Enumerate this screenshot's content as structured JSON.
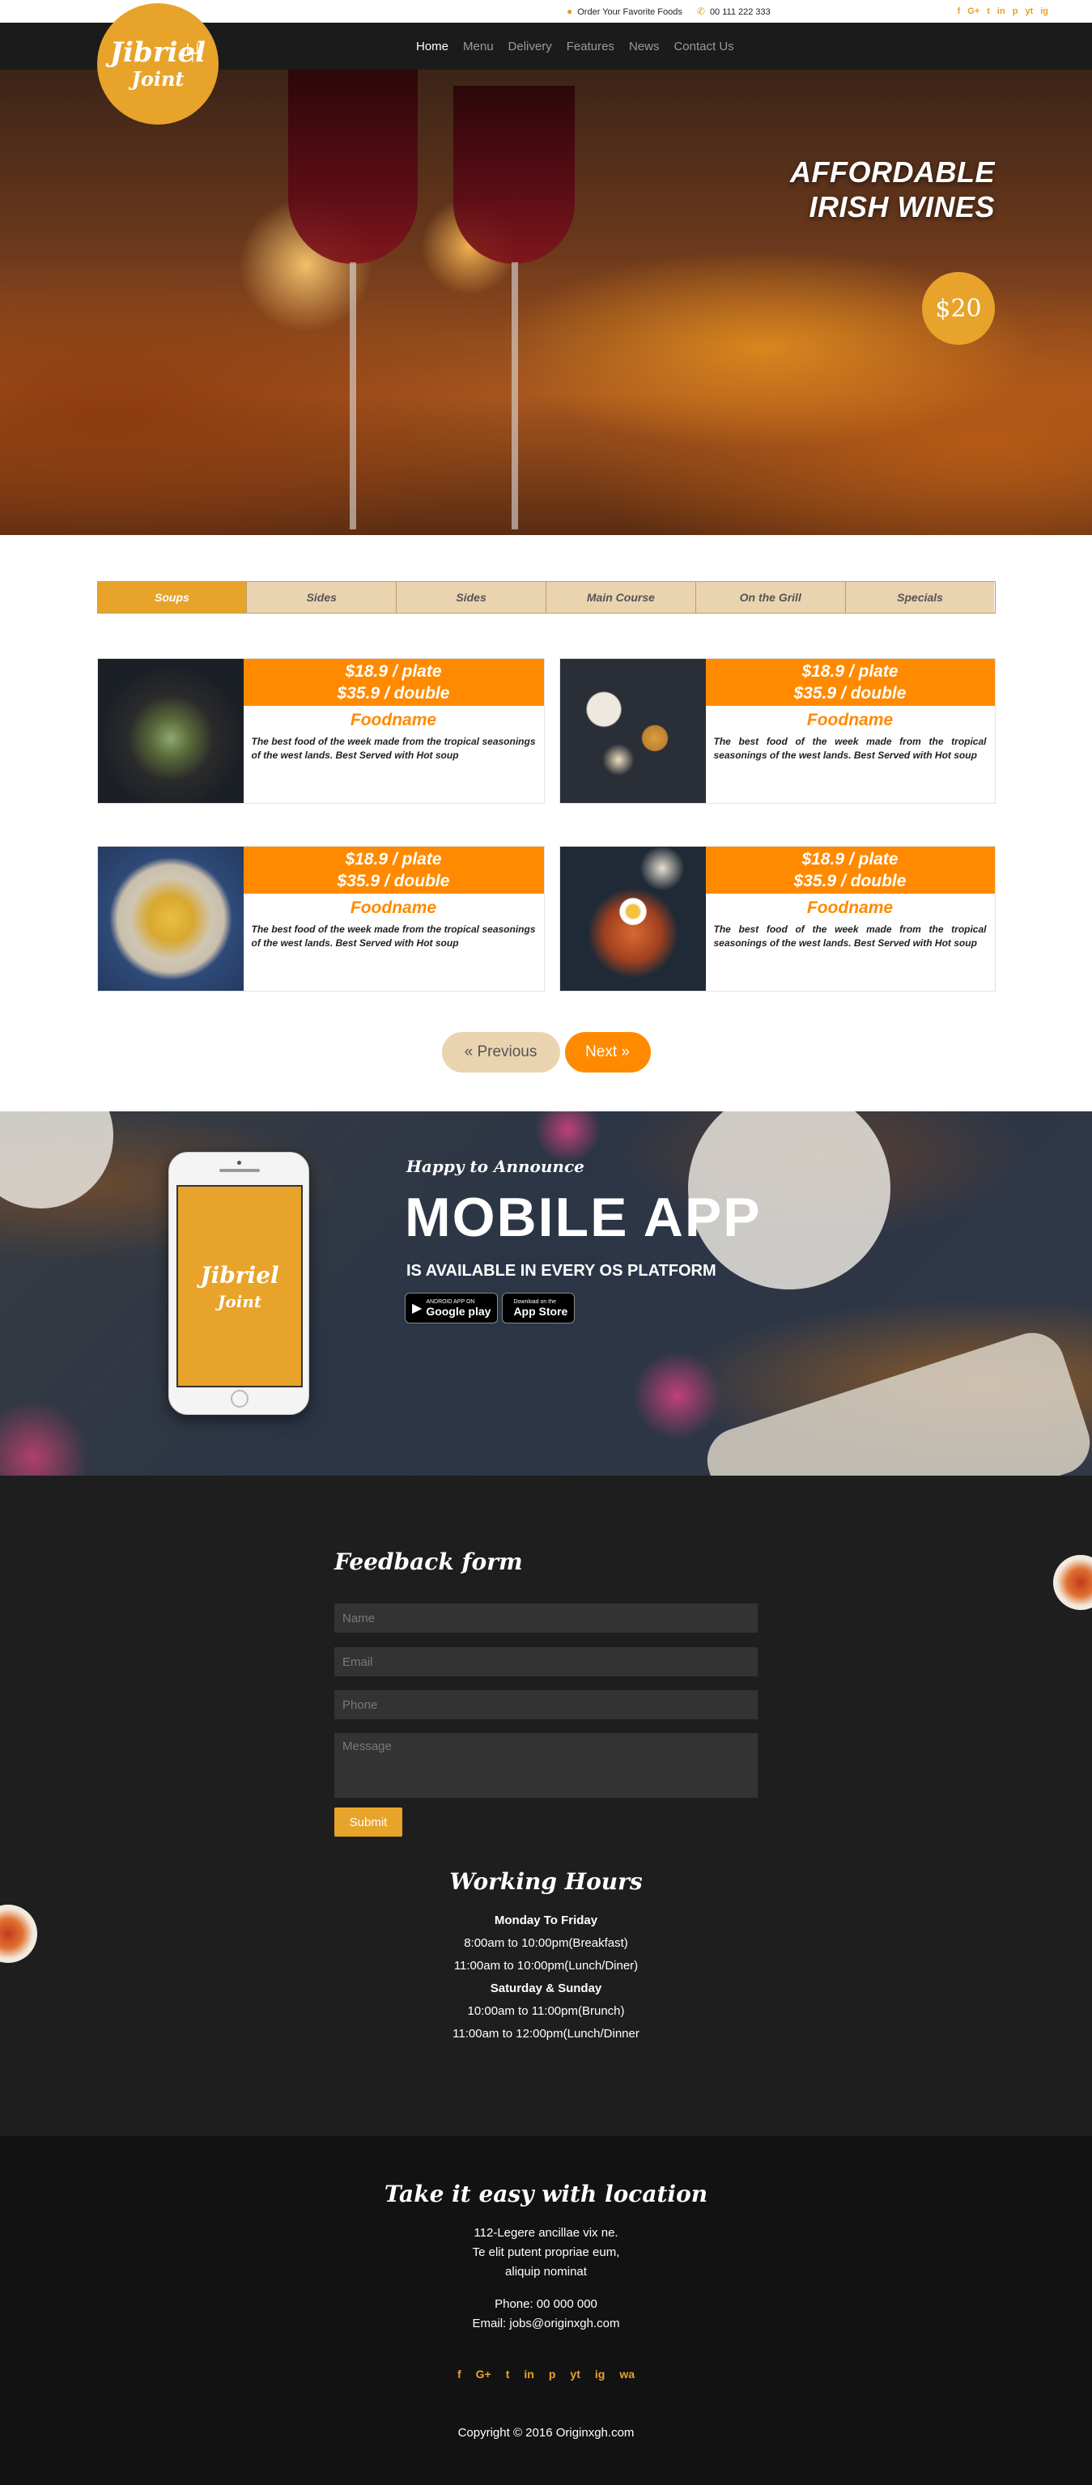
{
  "topbar": {
    "order_text": "Order Your Favorite Foods",
    "phone": "00 111 222 333",
    "social": [
      "f",
      "G+",
      "t",
      "in",
      "p",
      "yt",
      "ig"
    ]
  },
  "logo": {
    "line1": "Jibriel",
    "line2": "Joint"
  },
  "nav": {
    "items": [
      "Home",
      "Menu",
      "Delivery",
      "Features",
      "News",
      "Contact Us"
    ],
    "active": "Home"
  },
  "hero": {
    "title_line1": "AFFORDABLE",
    "title_line2": "IRISH WINES",
    "price": "$20"
  },
  "menu": {
    "tabs": [
      "Soups",
      "Sides",
      "Sides",
      "Main Course",
      "On the Grill",
      "Specials"
    ],
    "active_tab": "Soups",
    "items": [
      {
        "price_plate": "$18.9 / plate",
        "price_double": "$35.9 / double",
        "name": "Foodname",
        "desc": "The best food of the week made from the tropical seasonings of the west lands. Best Served with Hot soup"
      },
      {
        "price_plate": "$18.9 / plate",
        "price_double": "$35.9 / double",
        "name": "Foodname",
        "desc": "The best food of the week made from the tropical seasonings of the west lands. Best Served with Hot soup"
      },
      {
        "price_plate": "$18.9 / plate",
        "price_double": "$35.9 / double",
        "name": "Foodname",
        "desc": "The best food of the week made from the tropical seasonings of the west lands. Best Served with Hot soup"
      },
      {
        "price_plate": "$18.9 / plate",
        "price_double": "$35.9 / double",
        "name": "Foodname",
        "desc": "The best food of the week made from the tropical seasonings of the west lands. Best Served with Hot soup"
      }
    ],
    "prev_label": "« Previous",
    "next_label": "Next »"
  },
  "app": {
    "announce": "Happy to Announce",
    "title": "MOBILE APP",
    "subtitle": "IS AVAILABLE IN EVERY OS PLATFORM",
    "google_small": "ANDROID APP ON",
    "google_big": "Google play",
    "apple_small": "Download on the",
    "apple_big": "App Store"
  },
  "feedback": {
    "title": "Feedback form",
    "name_placeholder": "Name",
    "email_placeholder": "Email",
    "phone_placeholder": "Phone",
    "message_placeholder": "Message",
    "submit_label": "Submit"
  },
  "hours": {
    "title": "Working Hours",
    "weekday_label": "Monday To Friday",
    "weekday_1": "8:00am to 10:00pm(Breakfast)",
    "weekday_2": "11:00am to 10:00pm(Lunch/Diner)",
    "weekend_label": "Saturday & Sunday",
    "weekend_1": "10:00am to 11:00pm(Brunch)",
    "weekend_2": "11:00am to 12:00pm(Lunch/Dinner"
  },
  "footer": {
    "title": "Take it easy with location",
    "addr_1": "112-Legere ancillae vix ne.",
    "addr_2": "Te elit putent propriae eum,",
    "addr_3": "aliquip nominat",
    "phone": "Phone: 00 000 000",
    "email": "Email: jobs@originxgh.com",
    "social": [
      "f",
      "G+",
      "t",
      "in",
      "p",
      "yt",
      "ig",
      "wa"
    ],
    "copyright": "Copyright © 2016 Originxgh.com"
  },
  "colors": {
    "accent": "#e8a32b",
    "orange": "#ff8a00",
    "tab_bg": "#ead4b0",
    "dark": "#1e1e1e"
  }
}
